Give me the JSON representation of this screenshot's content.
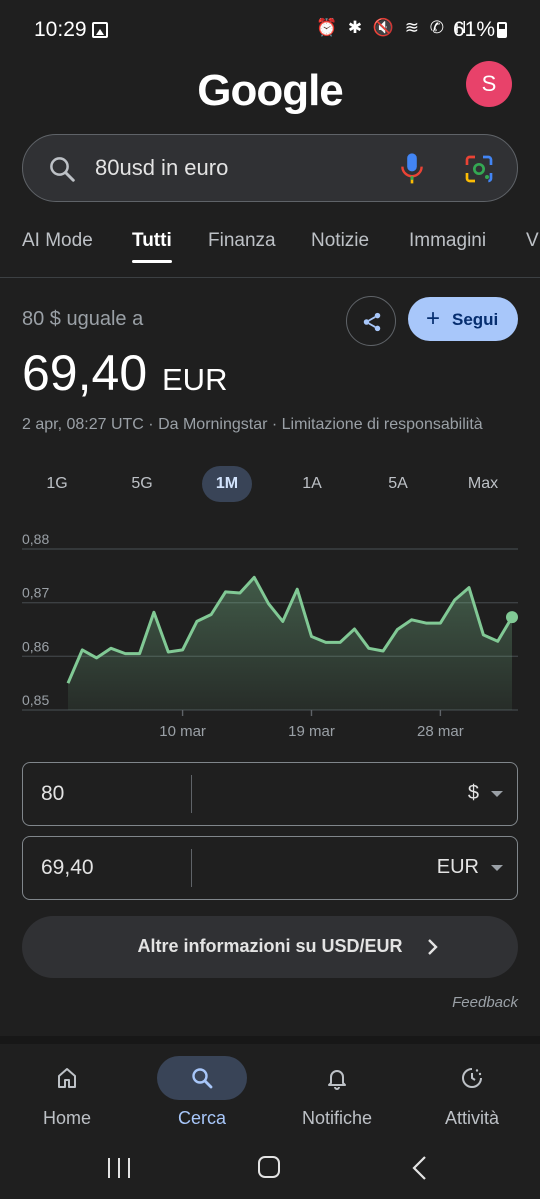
{
  "status_bar": {
    "time": "10:29",
    "icons": "⏰ ✱ 🔇 ≋ ✆ ıl",
    "battery": "61%"
  },
  "header": {
    "logo": "Google",
    "avatar_letter": "S"
  },
  "search": {
    "query": "80usd in euro"
  },
  "tabs": [
    "AI Mode",
    "Tutti",
    "Finanza",
    "Notizie",
    "Immagini",
    "V"
  ],
  "result": {
    "equals_label": "80 $ uguale a",
    "follow_label": "Segui",
    "value": "69,40",
    "currency": "EUR",
    "meta": "2 apr, 08:27 UTC · Da Morningstar · Limitazione di responsabilità"
  },
  "ranges": [
    "1G",
    "5G",
    "1M",
    "1A",
    "5A",
    "Max"
  ],
  "active_range": "1M",
  "chart_data": {
    "type": "area",
    "title": "",
    "xlabel": "",
    "ylabel": "",
    "ylim": [
      0.85,
      0.88
    ],
    "yticks": [
      "0,88",
      "0,87",
      "0,86",
      "0,85"
    ],
    "yticks_values": [
      0.88,
      0.87,
      0.86,
      0.85
    ],
    "x_ticks": [
      {
        "label": "10 mar",
        "index": 8
      },
      {
        "label": "19 mar",
        "index": 17
      },
      {
        "label": "28 mar",
        "index": 26
      }
    ],
    "series": [
      {
        "values": [
          0.855,
          0.8612,
          0.8597,
          0.8615,
          0.8605,
          0.8605,
          0.8682,
          0.8608,
          0.8612,
          0.8665,
          0.8678,
          0.872,
          0.8718,
          0.8747,
          0.8698,
          0.8665,
          0.8725,
          0.8637,
          0.8626,
          0.8626,
          0.8651,
          0.8615,
          0.861,
          0.865,
          0.8668,
          0.8662,
          0.8662,
          0.8705,
          0.8728,
          0.864,
          0.8628,
          0.8673
        ]
      }
    ],
    "grid": true,
    "colors": {
      "line": "#81c995",
      "fill": "#81c995",
      "grid": "#3c4043"
    }
  },
  "converter": {
    "from": {
      "amount": "80",
      "unit": "$"
    },
    "to": {
      "amount": "69,40",
      "unit": "EUR"
    }
  },
  "more_info": "Altre informazioni su USD/EUR",
  "feedback": "Feedback",
  "bottom_nav": [
    {
      "label": "Home",
      "icon": "home-icon"
    },
    {
      "label": "Cerca",
      "icon": "search-icon"
    },
    {
      "label": "Notifiche",
      "icon": "bell-icon"
    },
    {
      "label": "Attività",
      "icon": "activity-icon"
    }
  ],
  "active_nav": "Cerca",
  "accent_colors": {
    "follow_bg": "#a8c7fa",
    "active_bg": "#394457",
    "avatar_bg": "#e8426a"
  }
}
